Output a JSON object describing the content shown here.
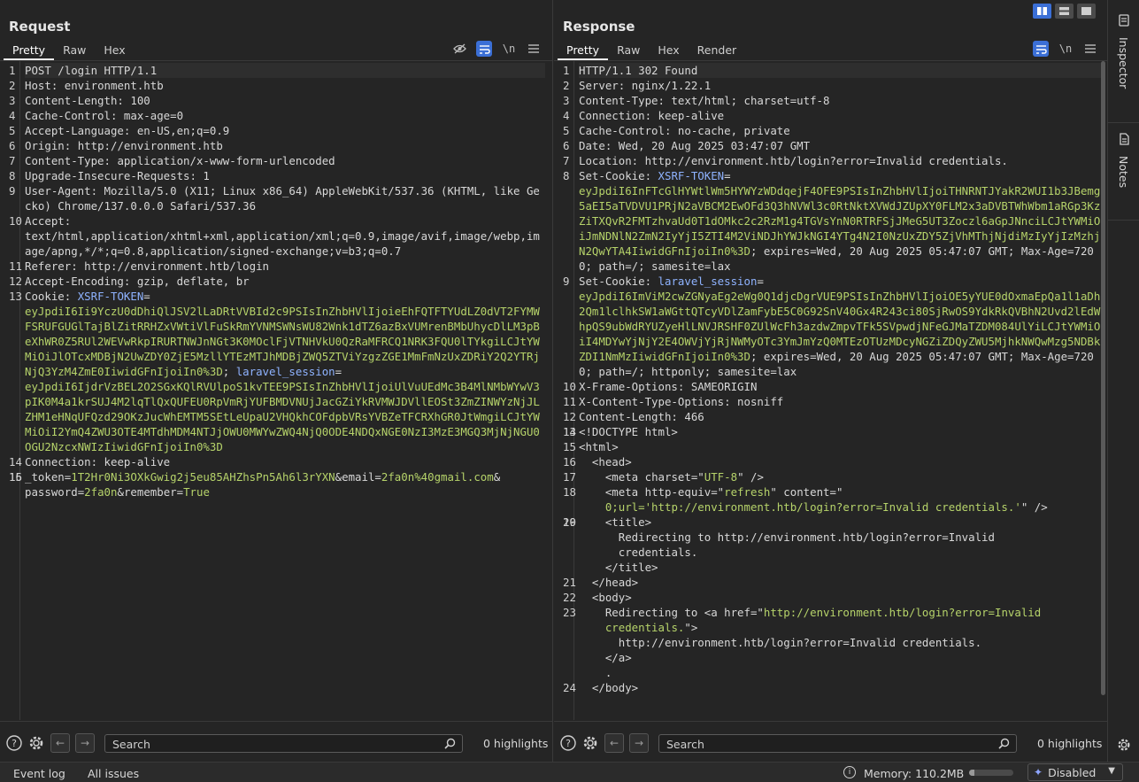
{
  "request": {
    "title": "Request",
    "tabs": [
      "Pretty",
      "Raw",
      "Hex"
    ],
    "active_tab": "Pretty",
    "newline_label": "\\n",
    "lines": [
      {
        "n": "1",
        "parts": [
          {
            "t": "POST /login HTTP/1.1",
            "c": "k"
          }
        ],
        "hl": true
      },
      {
        "n": "2",
        "parts": [
          {
            "t": "Host: ",
            "c": "k"
          },
          {
            "t": "environment.htb",
            "c": "k"
          }
        ]
      },
      {
        "n": "3",
        "parts": [
          {
            "t": "Content-Length: ",
            "c": "k"
          },
          {
            "t": "100",
            "c": "k"
          }
        ]
      },
      {
        "n": "4",
        "parts": [
          {
            "t": "Cache-Control: ",
            "c": "k"
          },
          {
            "t": "max-age=0",
            "c": "k"
          }
        ]
      },
      {
        "n": "5",
        "parts": [
          {
            "t": "Accept-Language: ",
            "c": "k"
          },
          {
            "t": "en-US,en;q=0.9",
            "c": "k"
          }
        ]
      },
      {
        "n": "6",
        "parts": [
          {
            "t": "Origin: ",
            "c": "k"
          },
          {
            "t": "http://environment.htb",
            "c": "k"
          }
        ]
      },
      {
        "n": "7",
        "parts": [
          {
            "t": "Content-Type: ",
            "c": "k"
          },
          {
            "t": "application/x-www-form-urlencoded",
            "c": "k"
          }
        ]
      },
      {
        "n": "8",
        "parts": [
          {
            "t": "Upgrade-Insecure-Requests: ",
            "c": "k"
          },
          {
            "t": "1",
            "c": "k"
          }
        ]
      },
      {
        "n": "9",
        "parts": [
          {
            "t": "User-Agent: ",
            "c": "k"
          },
          {
            "t": "Mozilla/5.0 (X11; Linux x86_64) AppleWebKit/537.36 (KHTML, like Gecko) Chrome/137.0.0.0 Safari/537.36",
            "c": "k"
          }
        ]
      },
      {
        "n": "10",
        "parts": [
          {
            "t": "Accept: ",
            "c": "k"
          },
          {
            "t": "\ntext/html,application/xhtml+xml,application/xml;q=0.9,image/avif,image/webp,image/apng,*/*;q=0.8,application/signed-exchange;v=b3;q=0.7",
            "c": "k"
          }
        ]
      },
      {
        "n": "11",
        "parts": [
          {
            "t": "Referer: ",
            "c": "k"
          },
          {
            "t": "http://environment.htb/login",
            "c": "k"
          }
        ]
      },
      {
        "n": "12",
        "parts": [
          {
            "t": "Accept-Encoding: ",
            "c": "k"
          },
          {
            "t": "gzip, deflate, br",
            "c": "k"
          }
        ]
      },
      {
        "n": "13",
        "parts": [
          {
            "t": "Cookie: ",
            "c": "k"
          },
          {
            "t": "XSRF-TOKEN",
            "c": "b"
          },
          {
            "t": "=\n",
            "c": "k"
          },
          {
            "t": "eyJpdiI6Ii9YczU0dDhiQlJSV2lLaDRtVVBId2c9PSIsInZhbHVlIjoieEhFQTFTYUdLZ0dVT2FYMWFSRUFGUGlTajBlZitRRHZxVWtiVlFuSkRmYVNMSWNsWU82Wnk1dTZ6azBxVUMrenBMbUhycDlLM3pBeXhWR0Z5RUl2WEVwRkpIRURTNWJnNGt3K0MOclFjVTNHVkU0QzRaMFRCQ1NRK3FQU0lTYkgiLCJtYWMiOiJlOTcxMDBjN2UwZDY0ZjE5MzllYTEzMTJhMDBjZWQ5ZTViYzgzZGE1MmFmNzUxZDRiY2Q2YTRjNjQ3YzM4ZmE0IiwidGFnIjoiIn0%3D",
            "c": "v"
          },
          {
            "t": "; ",
            "c": "k"
          },
          {
            "t": "laravel_session",
            "c": "b"
          },
          {
            "t": "=\n",
            "c": "k"
          },
          {
            "t": "eyJpdiI6IjdrVzBEL2O2SGxKQlRVUlpoS1kvTEE9PSIsInZhbHVlIjoiUlVuUEdMc3B4MlNMbWYwV3pIK0M4a1krSUJ4M2lqTlQxQUFEU0RpVmRjYUFBMDVNUjJacGZiYkRVMWJDVllEOSt3ZmZINWYzNjJLZHM1eHNqUFQzd29OKzJucWhEMTM5SEtLeUpaU2VHQkhCOFdpbVRsYVBZeTFCRXhGR0JtWmgiLCJtYWMiOiI2YmQ4ZWU3OTE4MTdhMDM4NTJjOWU0MWYwZWQ4NjQ0ODE4NDQxNGE0NzI3MzE3MGQ3MjNjNGU0OGU2NzcxNWIzIiwidGFnIjoiIn0%3D",
            "c": "v"
          }
        ]
      },
      {
        "n": "14",
        "parts": [
          {
            "t": "Connection: ",
            "c": "k"
          },
          {
            "t": "keep-alive",
            "c": "k"
          }
        ]
      },
      {
        "n": "15",
        "parts": [
          {
            "t": "",
            "c": "k"
          }
        ]
      },
      {
        "n": "16",
        "parts": [
          {
            "t": "_token",
            "c": "k"
          },
          {
            "t": "=",
            "c": "k"
          },
          {
            "t": "1T2Hr0Ni3OXkGwig2j5eu85AHZhsPn5Ah6l3rYXN",
            "c": "v"
          },
          {
            "t": "&",
            "c": "k"
          },
          {
            "t": "email",
            "c": "k"
          },
          {
            "t": "=",
            "c": "k"
          },
          {
            "t": "2fa0n%40gmail.com",
            "c": "v"
          },
          {
            "t": "&\n",
            "c": "k"
          },
          {
            "t": "password",
            "c": "k"
          },
          {
            "t": "=",
            "c": "k"
          },
          {
            "t": "2fa0n",
            "c": "v"
          },
          {
            "t": "&",
            "c": "k"
          },
          {
            "t": "remember",
            "c": "k"
          },
          {
            "t": "=",
            "c": "k"
          },
          {
            "t": "True",
            "c": "v"
          }
        ]
      }
    ],
    "search_placeholder": "Search",
    "highlights": "0 highlights"
  },
  "response": {
    "title": "Response",
    "tabs": [
      "Pretty",
      "Raw",
      "Hex",
      "Render"
    ],
    "active_tab": "Pretty",
    "newline_label": "\\n",
    "lines": [
      {
        "n": "1",
        "parts": [
          {
            "t": "HTTP/1.1 302 Found",
            "c": "k"
          }
        ],
        "hl": true
      },
      {
        "n": "2",
        "parts": [
          {
            "t": "Server: nginx/1.22.1",
            "c": "k"
          }
        ]
      },
      {
        "n": "3",
        "parts": [
          {
            "t": "Content-Type: text/html; charset=utf-8",
            "c": "k"
          }
        ]
      },
      {
        "n": "4",
        "parts": [
          {
            "t": "Connection: keep-alive",
            "c": "k"
          }
        ]
      },
      {
        "n": "5",
        "parts": [
          {
            "t": "Cache-Control: no-cache, private",
            "c": "k"
          }
        ]
      },
      {
        "n": "6",
        "parts": [
          {
            "t": "Date: Wed, 20 Aug 2025 03:47:07 GMT",
            "c": "k"
          }
        ]
      },
      {
        "n": "7",
        "parts": [
          {
            "t": "Location: http://environment.htb/login?error=Invalid credentials.",
            "c": "k"
          }
        ]
      },
      {
        "n": "8",
        "parts": [
          {
            "t": "Set-Cookie: ",
            "c": "k"
          },
          {
            "t": "XSRF-TOKEN",
            "c": "b"
          },
          {
            "t": "=\n",
            "c": "k"
          },
          {
            "t": "eyJpdiI6InFTcGlHYWtlWm5HYWYzWDdqejF4OFE9PSIsInZhbHVlIjoiTHNRNTJYakR2WUI1b3JBemg5aEI5aTVDVU1PRjN2aVBCM2EwOFd3Q3hNVWl3c0RtNktXVWdJZUpXY0FLM2x3aDVBTWhWbm1aRGp3KzZiTXQvR2FMTzhvaUd0T1dOMkc2c2RzM1g4TGVsYnN0RTRFSjJMeG5UT3Zoczl6aGpJNnciLCJtYWMiOiJmNDNlN2ZmN2IyYjI5ZTI4M2ViNDJhYWJkNGI4YTg4N2I0NzUxZDY5ZjVhMThjNjdiMzIyYjIzMzhjN2QwYTA4IiwidGFnIjoiIn0%3D",
            "c": "v"
          },
          {
            "t": "; expires=Wed, 20 Aug 2025 05:47:07 GMT; Max-Age=7200; path=/; samesite=lax",
            "c": "k"
          }
        ]
      },
      {
        "n": "9",
        "parts": [
          {
            "t": "Set-Cookie: ",
            "c": "k"
          },
          {
            "t": "laravel_session",
            "c": "b"
          },
          {
            "t": "=\n",
            "c": "k"
          },
          {
            "t": "eyJpdiI6ImViM2cwZGNyaEg2eWg0Q1djcDgrVUE9PSIsInZhbHVlIjoiOE5yYUE0dOxmaEpQa1l1aDh2Qm1lclhkSW1aWGttQTcyVDlZamFybE5C0G92SnV40Gx4R243ci80SjRwOS9YdkRkQVBhN2Uvd2lEdWhpQS9ubWdRYUZyeHlLNVJRSHF0ZUlWcFh3azdwZmpvTFk5SVpwdjNFeGJMaTZDM084UlYiLCJtYWMiOiI4MDYwYjNjY2E4OWVjYjRjNWMyOTc3YmJmYzQ0MTEzOTUzMDcyNGZiZDQyZWU5MjhkNWQwMzg5NDBkZDI1NmMzIiwidGFnIjoiIn0%3D",
            "c": "v"
          },
          {
            "t": "; expires=Wed, 20 Aug 2025 05:47:07 GMT; Max-Age=7200; path=/; httponly; samesite=lax",
            "c": "k"
          }
        ]
      },
      {
        "n": "10",
        "parts": [
          {
            "t": "X-Frame-Options: SAMEORIGIN",
            "c": "k"
          }
        ]
      },
      {
        "n": "11",
        "parts": [
          {
            "t": "X-Content-Type-Options: nosniff",
            "c": "k"
          }
        ]
      },
      {
        "n": "12",
        "parts": [
          {
            "t": "Content-Length: 466",
            "c": "k"
          }
        ]
      },
      {
        "n": "13",
        "parts": [
          {
            "t": "",
            "c": "k"
          }
        ]
      },
      {
        "n": "14",
        "parts": [
          {
            "t": "<!DOCTYPE html>",
            "c": "k"
          }
        ]
      },
      {
        "n": "15",
        "parts": [
          {
            "t": "<html>",
            "c": "k"
          }
        ]
      },
      {
        "n": "16",
        "parts": [
          {
            "t": "  <head>",
            "c": "k"
          }
        ]
      },
      {
        "n": "17",
        "parts": [
          {
            "t": "    <meta ",
            "c": "k"
          },
          {
            "t": "charset",
            "c": "k"
          },
          {
            "t": "=\"",
            "c": "k"
          },
          {
            "t": "UTF-8",
            "c": "v"
          },
          {
            "t": "\" />",
            "c": "k"
          }
        ]
      },
      {
        "n": "18",
        "parts": [
          {
            "t": "    <meta ",
            "c": "k"
          },
          {
            "t": "http-equiv",
            "c": "k"
          },
          {
            "t": "=\"",
            "c": "k"
          },
          {
            "t": "refresh",
            "c": "v"
          },
          {
            "t": "\" content=\"\n    ",
            "c": "k"
          },
          {
            "t": "0;url='http://environment.htb/login?error=Invalid credentials.'",
            "c": "v"
          },
          {
            "t": "\" />",
            "c": "k"
          }
        ]
      },
      {
        "n": "19",
        "parts": [
          {
            "t": "",
            "c": "k"
          }
        ]
      },
      {
        "n": "20",
        "parts": [
          {
            "t": "    <title>\n      Redirecting to http://environment.htb/login?error=Invalid\n      credentials.\n    </title>",
            "c": "k"
          }
        ]
      },
      {
        "n": "21",
        "parts": [
          {
            "t": "  </head>",
            "c": "k"
          }
        ]
      },
      {
        "n": "22",
        "parts": [
          {
            "t": "  <body>",
            "c": "k"
          }
        ]
      },
      {
        "n": "23",
        "parts": [
          {
            "t": "    Redirecting to <a ",
            "c": "k"
          },
          {
            "t": "href",
            "c": "k"
          },
          {
            "t": "=\"",
            "c": "k"
          },
          {
            "t": "http://environment.htb/login?error=Invalid\n    credentials.",
            "c": "v"
          },
          {
            "t": "\">\n      http://environment.htb/login?error=Invalid credentials.\n    </a>\n    .",
            "c": "k"
          }
        ]
      },
      {
        "n": "24",
        "parts": [
          {
            "t": "  </body>",
            "c": "k"
          }
        ]
      }
    ],
    "search_placeholder": "Search",
    "highlights": "0 highlights"
  },
  "side_rail": {
    "inspector": "Inspector",
    "notes": "Notes"
  },
  "status_bar": {
    "event_log": "Event log",
    "all_issues": "All issues",
    "memory": "Memory: 110.2MB",
    "memory_fraction": 0.12,
    "ai_state": "Disabled"
  },
  "colors": {
    "accent": "#3b6fd6",
    "value": "#b6d36a",
    "key": "#8fb3ff"
  }
}
